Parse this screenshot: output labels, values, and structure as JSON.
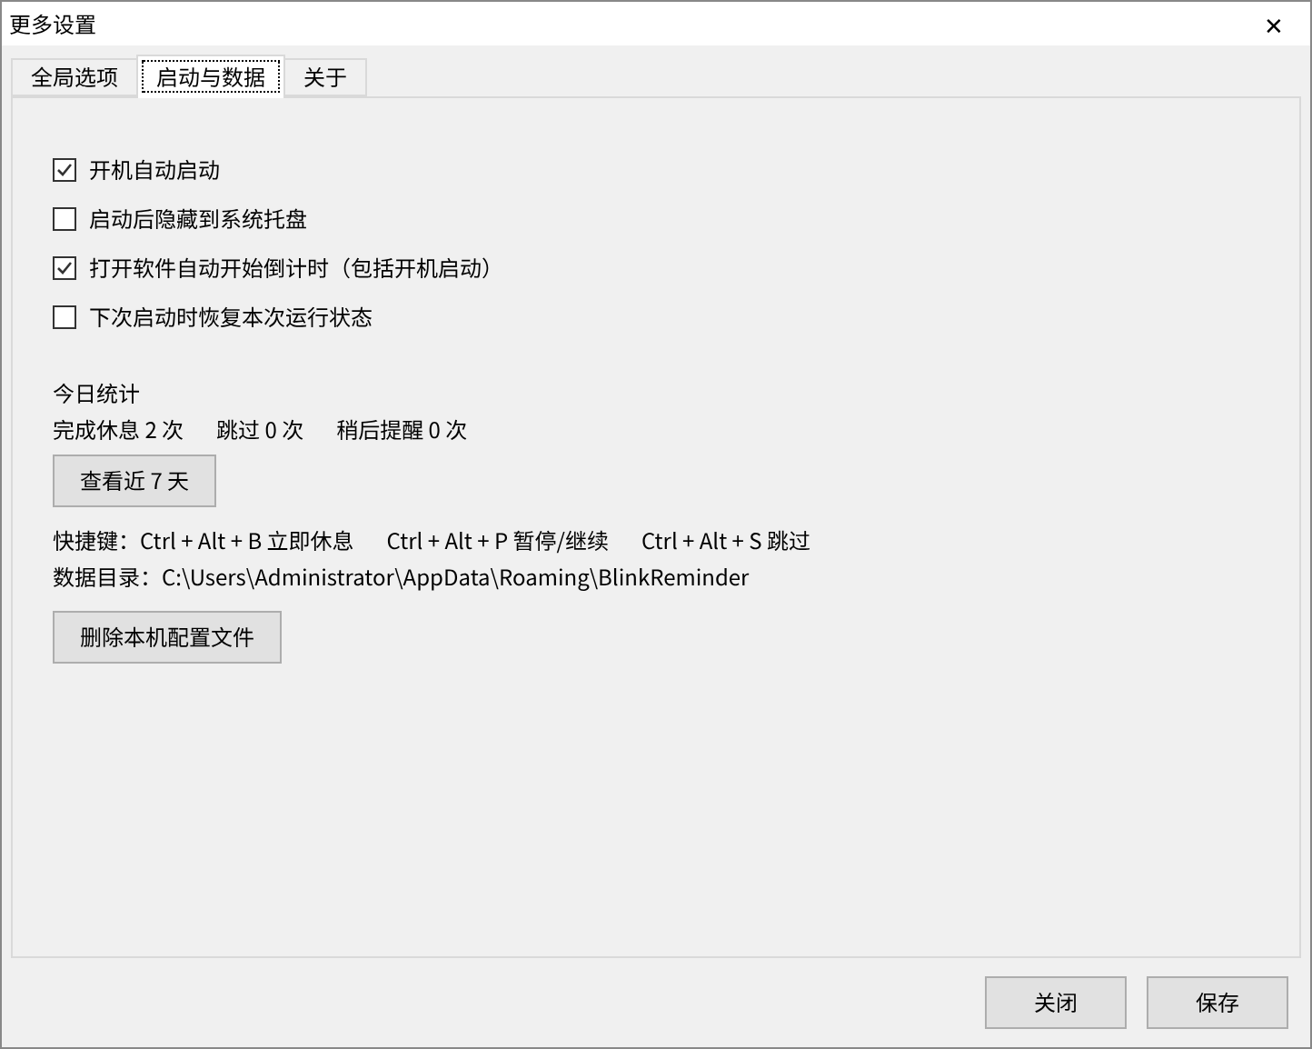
{
  "window": {
    "title": "更多设置",
    "close_glyph": "✕"
  },
  "tabs": [
    {
      "label": "全局选项",
      "selected": false
    },
    {
      "label": "启动与数据",
      "selected": true
    },
    {
      "label": "关于",
      "selected": false
    }
  ],
  "options": [
    {
      "label": "开机自动启动",
      "checked": true
    },
    {
      "label": "启动后隐藏到系统托盘",
      "checked": false
    },
    {
      "label": "打开软件自动开始倒计时（包括开机启动）",
      "checked": true
    },
    {
      "label": "下次启动时恢复本次运行状态",
      "checked": false
    }
  ],
  "stats": {
    "title": "今日统计",
    "items": [
      "完成休息 2 次",
      "跳过 0 次",
      "稍后提醒 0 次"
    ],
    "button": "查看近 7 天"
  },
  "hotkeys": {
    "label": "快捷键：",
    "items": [
      "Ctrl + Alt + B 立即休息",
      "Ctrl + Alt + P 暂停/继续",
      "Ctrl + Alt + S 跳过"
    ]
  },
  "data_dir": {
    "label": "数据目录：",
    "path": "C:\\Users\\Administrator\\AppData\\Roaming\\BlinkReminder"
  },
  "delete_button": "删除本机配置文件",
  "buttons": [
    "关闭",
    "保存"
  ]
}
